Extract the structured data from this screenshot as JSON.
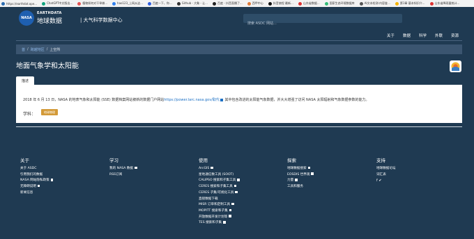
{
  "bookmarks": [
    {
      "label": "https://earthdat.ope...",
      "color": "#2b6cb0"
    },
    {
      "label": "ChatGPT中文版出...",
      "color": "#10a37f"
    },
    {
      "label": "植物如何对干旱做...",
      "color": "#e55353"
    },
    {
      "label": "hao123_上网从这...",
      "color": "#2f80ed"
    },
    {
      "label": "百度一下，你...",
      "color": "#2f5fe0"
    },
    {
      "label": "Github - 大象 - 让...",
      "color": "#333333"
    },
    {
      "label": "百度 - 抖音直播了...",
      "color": "#222222"
    },
    {
      "label": "西甲中心",
      "color": "#e07b39"
    },
    {
      "label": "抖音旅程 最新...",
      "color": "#111111"
    },
    {
      "label": "山东省数据...",
      "color": "#d33"
    },
    {
      "label": "国家生态环境数据库",
      "color": "#3b7"
    },
    {
      "label": "AI文本检测-内容鉴...",
      "color": "#555"
    },
    {
      "label": "第1章 基本知识介...",
      "color": "#f5b400"
    },
    {
      "label": "山东省降雨量统计...",
      "color": "#d33"
    }
  ],
  "header": {
    "logo_text": "NASA",
    "brand_top": "EARTHDATA",
    "brand_cn": "地球数据",
    "site_title": "| 大气科学数据中心",
    "search_placeholder": "搜索 ASDC 网站..."
  },
  "nav": [
    "关于",
    "数据",
    "科学",
    "外联",
    "资源"
  ],
  "breadcrumb": {
    "items": [
      "首",
      "跨越地区"
    ],
    "current": "上空所"
  },
  "page_title": "地面气象学和太阳能",
  "tab_label": "描述",
  "card": {
    "text_before": "2018 年 6 月 13 日，NASA 的地表气象和太阳能 (SSE) 数据档案网站被新的数据门户网站",
    "link": "https://power.larc.nasa.gov/取代",
    "text_after": "其中包含改进的太阳能气象数据，并大大增强了访问 NASA 太阳辐射和气象数据参数的能力。",
    "subject_label": "学科：",
    "subject_tag": "地球物理"
  },
  "footer": {
    "columns": [
      {
        "head": "关于",
        "links": [
          {
            "label": "关于 ASDC",
            "ext": false
          },
          {
            "label": "引用我们的数据",
            "ext": false
          },
          {
            "label": "NASA 网站隐私政策",
            "ext": true
          },
          {
            "label": "无障碍说明",
            "ext": true
          },
          {
            "label": "新闻信息",
            "ext": false
          }
        ]
      },
      {
        "head": "学习",
        "links": [
          {
            "label": "我的 NASA 数据",
            "ext": true
          },
          {
            "label": "RSS订阅",
            "ext": false
          }
        ]
      },
      {
        "head": "使用",
        "links": [
          {
            "label": "ArcGIS",
            "ext": true
          },
          {
            "label": "星地通信数工具 (SOOT)",
            "ext": false
          },
          {
            "label": "CALIPSO 搜索和子集工具",
            "ext": true
          },
          {
            "label": "CERES 搜索和子集工具",
            "ext": true
          },
          {
            "label": "CERES 子集/可视化工具",
            "ext": true
          },
          {
            "label": "直接数据下载",
            "ext": false
          },
          {
            "label": "MISR 订单和定制工具",
            "ext": true
          },
          {
            "label": "MOPITT 搜索和子集",
            "ext": true
          },
          {
            "label": "开放数据开发计划等",
            "ext": true
          },
          {
            "label": "TES 搜索和子集",
            "ext": true
          }
        ]
      },
      {
        "head": "探索",
        "links": [
          {
            "label": "地球数据搜索",
            "ext": true
          },
          {
            "label": "EOSDIS 世界观",
            "ext": true
          },
          {
            "label": "力量",
            "ext": true
          },
          {
            "label": "工具和服务",
            "ext": false
          }
        ]
      },
      {
        "head": "支持",
        "links": [
          {
            "label": "地球数据论坛",
            "ext": false
          },
          {
            "label": "词汇表",
            "ext": false
          }
        ]
      }
    ],
    "social": "f  ✔"
  }
}
